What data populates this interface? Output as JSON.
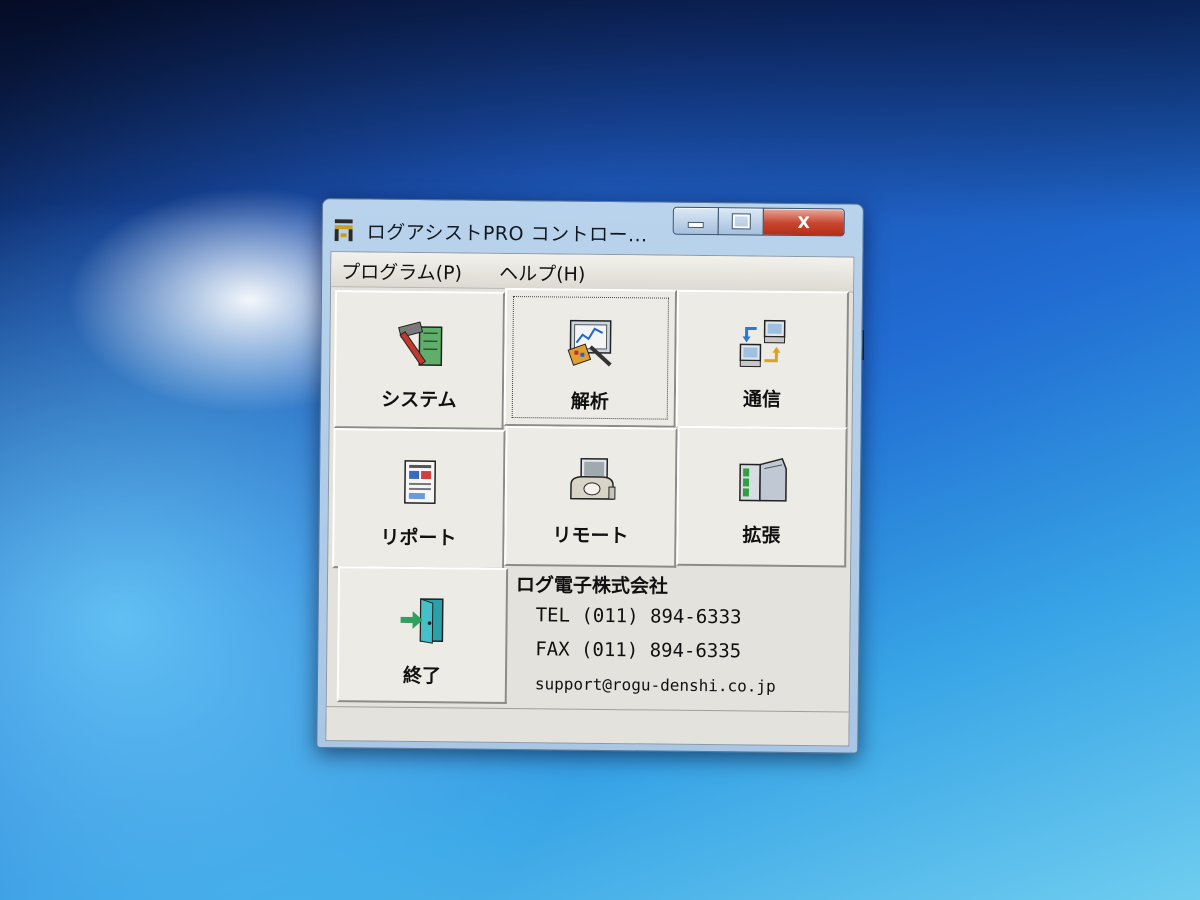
{
  "window": {
    "title": "ログアシストPRO コントロー...",
    "close_glyph": "X",
    "icon": "logassist-app-icon"
  },
  "menu": {
    "items": [
      {
        "label": "プログラム(P)"
      },
      {
        "label": "ヘルプ(H)"
      }
    ]
  },
  "tiles": [
    {
      "label": "システム",
      "icon": "hammer-ruler-icon"
    },
    {
      "label": "解析",
      "icon": "analysis-chart-icon"
    },
    {
      "label": "通信",
      "icon": "network-computers-icon"
    },
    {
      "label": "リポート",
      "icon": "report-document-icon"
    },
    {
      "label": "リモート",
      "icon": "telephone-icon"
    },
    {
      "label": "拡張",
      "icon": "expansion-box-icon"
    },
    {
      "label": "終了",
      "icon": "exit-door-icon"
    }
  ],
  "info": {
    "company": "ログ電子株式会社",
    "tel": "TEL (011) 894-6333",
    "fax": "FAX (011) 894-6335",
    "email": "support@rogu-denshi.co.jp"
  },
  "colors": {
    "close_button": "#c7442e",
    "window_frame": "#b9d3ec",
    "client_bg": "#e4e2dc"
  }
}
